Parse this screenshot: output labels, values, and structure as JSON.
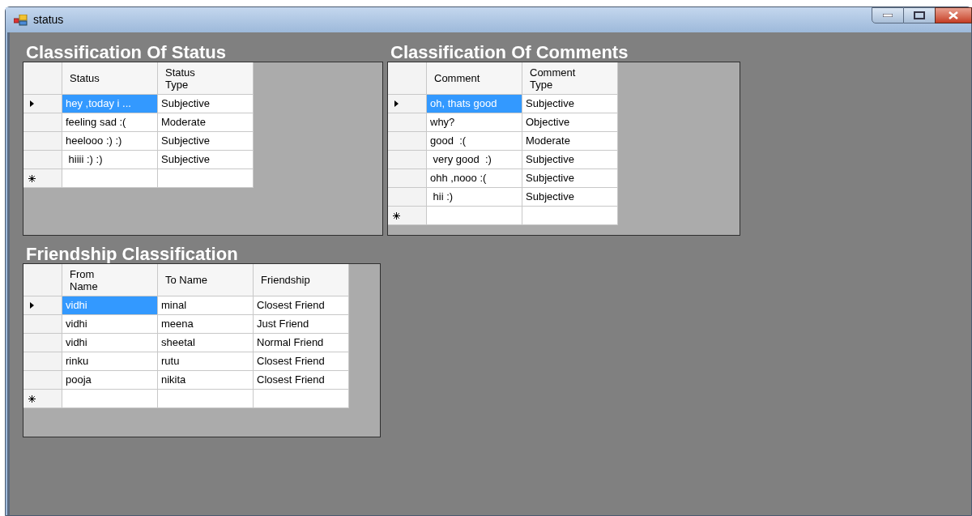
{
  "window": {
    "title": "status"
  },
  "grids": [
    {
      "title": "Classification Of Status",
      "has_new_row": true,
      "columns": [
        "Status",
        "Status Type"
      ],
      "rows": [
        {
          "selected": true,
          "cells": [
            "hey ,today i ...",
            "Subjective"
          ]
        },
        {
          "selected": false,
          "cells": [
            "feeling sad :(",
            "Moderate"
          ]
        },
        {
          "selected": false,
          "cells": [
            "heelooo :) :)",
            "Subjective"
          ]
        },
        {
          "selected": false,
          "cells": [
            " hiiii :) :)",
            "Subjective"
          ]
        }
      ]
    },
    {
      "title": "Classification Of Comments",
      "has_new_row": true,
      "columns": [
        "Comment",
        "Comment Type"
      ],
      "rows": [
        {
          "selected": true,
          "cells": [
            "oh, thats good",
            "Subjective"
          ]
        },
        {
          "selected": false,
          "cells": [
            "why?",
            "Objective"
          ]
        },
        {
          "selected": false,
          "cells": [
            "good  :(",
            "Moderate"
          ]
        },
        {
          "selected": false,
          "cells": [
            " very good  :)",
            "Subjective"
          ]
        },
        {
          "selected": false,
          "cells": [
            "ohh ,nooo :(",
            "Subjective"
          ]
        },
        {
          "selected": false,
          "cells": [
            " hii :)",
            "Subjective"
          ]
        }
      ]
    },
    {
      "title": "Friendship Classification",
      "has_new_row": true,
      "columns": [
        "From Name",
        "To Name",
        "Friendship"
      ],
      "rows": [
        {
          "selected": true,
          "cells": [
            "vidhi",
            "minal",
            "Closest Friend"
          ]
        },
        {
          "selected": false,
          "cells": [
            "vidhi",
            "meena",
            "Just Friend"
          ]
        },
        {
          "selected": false,
          "cells": [
            "vidhi",
            "sheetal",
            "Normal Friend"
          ]
        },
        {
          "selected": false,
          "cells": [
            "rinku",
            "rutu",
            "Closest Friend"
          ]
        },
        {
          "selected": false,
          "cells": [
            "pooja",
            "nikita",
            "Closest Friend"
          ]
        }
      ]
    }
  ]
}
